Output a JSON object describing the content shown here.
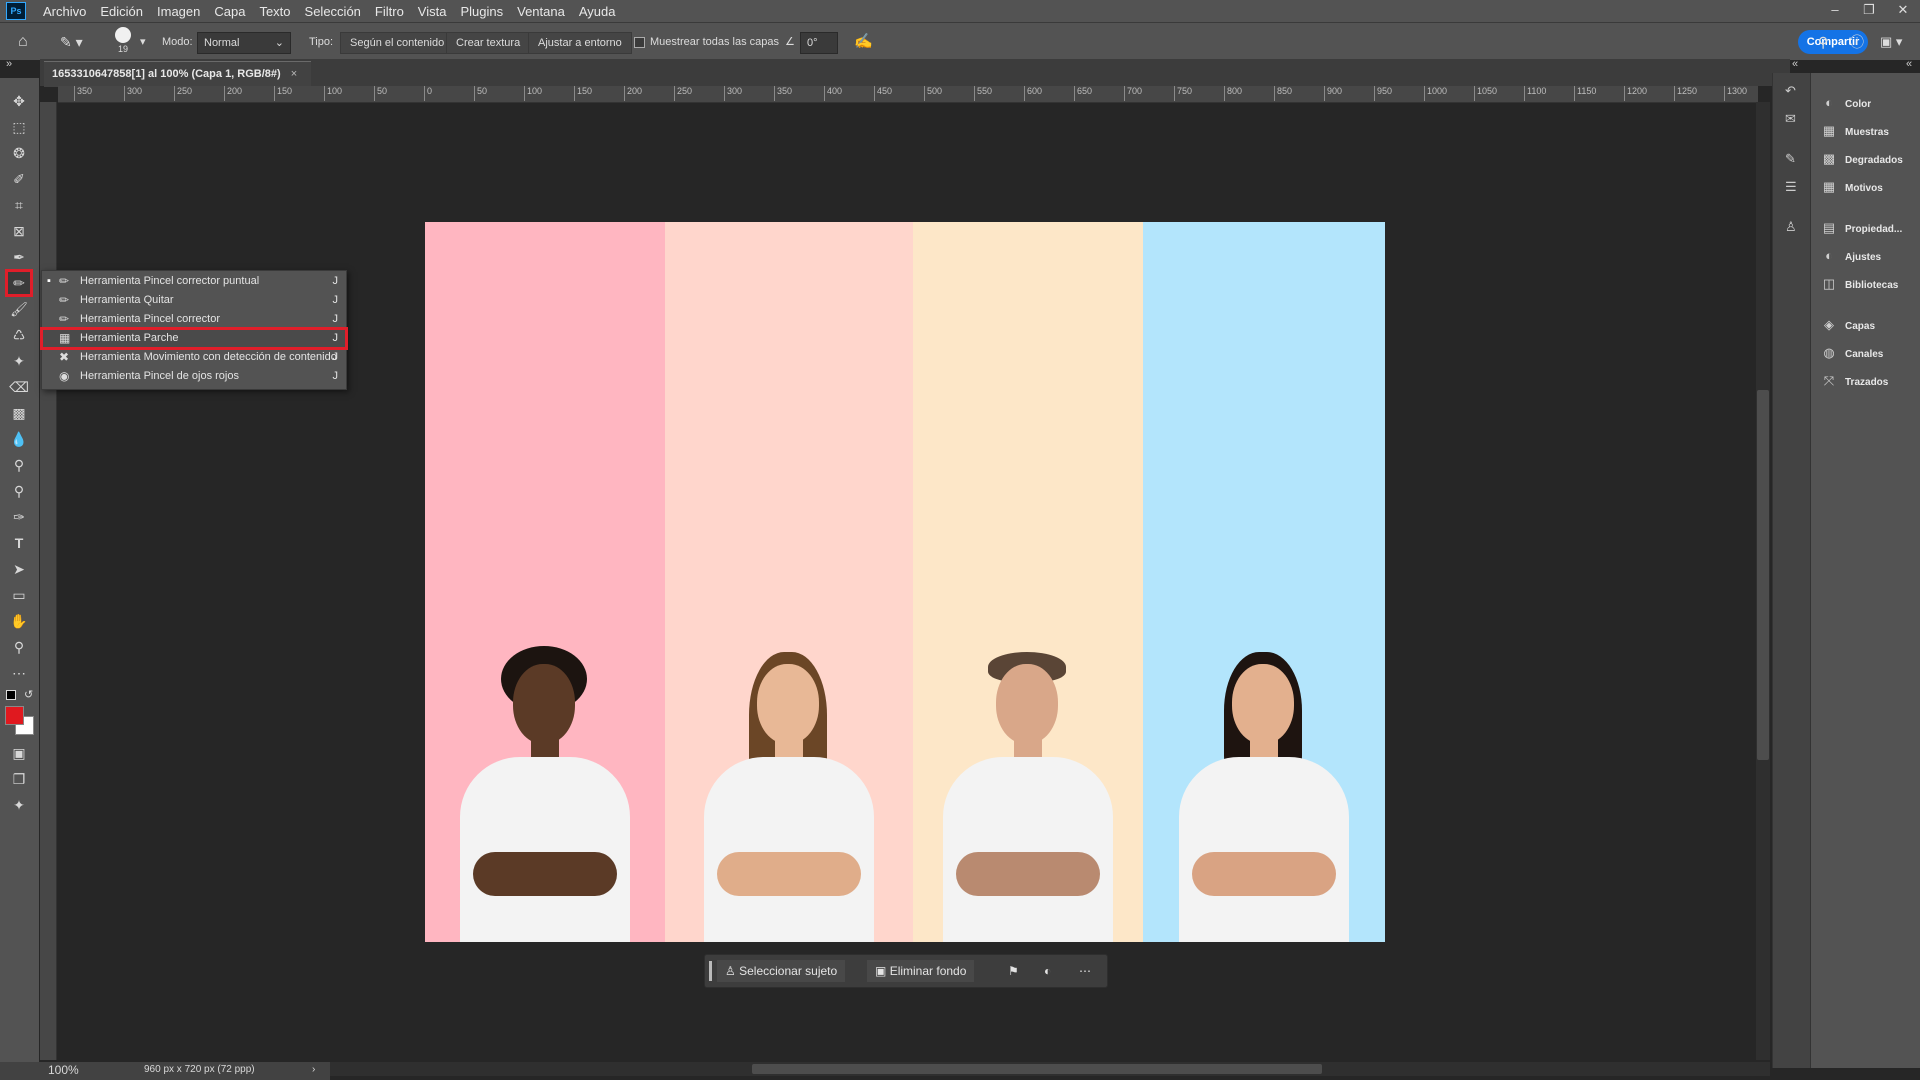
{
  "app": {
    "logo": "Ps"
  },
  "menu": [
    "Archivo",
    "Edición",
    "Imagen",
    "Capa",
    "Texto",
    "Selección",
    "Filtro",
    "Vista",
    "Plugins",
    "Ventana",
    "Ayuda"
  ],
  "options": {
    "brush_size": "19",
    "mode_label": "Modo:",
    "mode_value": "Normal",
    "type_label": "Tipo:",
    "type_buttons": [
      "Según el contenido",
      "Crear textura",
      "Ajustar a entorno"
    ],
    "sample_all_layers": "Muestrear todas las capas",
    "angle_value": "0°",
    "share": "Compartir"
  },
  "document": {
    "tab_title": "1653310647858[1] al 100% (Capa 1, RGB/8#)",
    "zoom": "100%",
    "doc_size": "960 px x 720 px (72 ppp)"
  },
  "ruler": {
    "h_ticks": [
      "350",
      "300",
      "250",
      "200",
      "150",
      "100",
      "50",
      "0",
      "50",
      "100",
      "150",
      "200",
      "250",
      "300",
      "350",
      "400",
      "450",
      "500",
      "550",
      "600",
      "650",
      "700",
      "750",
      "800",
      "850",
      "900",
      "950",
      "1000",
      "1050",
      "1100",
      "1150",
      "1200",
      "1250",
      "1300"
    ]
  },
  "flyout": {
    "items": [
      {
        "label": "Herramienta Pincel corrector puntual",
        "key": "J",
        "icon": "spot-healing-brush-icon",
        "active": true
      },
      {
        "label": "Herramienta Quitar",
        "key": "J",
        "icon": "remove-tool-icon",
        "active": false
      },
      {
        "label": "Herramienta Pincel corrector",
        "key": "J",
        "icon": "healing-brush-icon",
        "active": false
      },
      {
        "label": "Herramienta Parche",
        "key": "J",
        "icon": "patch-tool-icon",
        "active": false,
        "highlighted": true
      },
      {
        "label": "Herramienta Movimiento con detección de contenido",
        "key": "J",
        "icon": "content-aware-move-icon",
        "active": false
      },
      {
        "label": "Herramienta Pincel de ojos rojos",
        "key": "J",
        "icon": "red-eye-icon",
        "active": false
      }
    ]
  },
  "taskbar": {
    "select_subject": "Seleccionar sujeto",
    "remove_background": "Eliminar fondo"
  },
  "panels": {
    "group1": [
      "Color",
      "Muestras",
      "Degradados",
      "Motivos"
    ],
    "group2": [
      "Propiedad...",
      "Ajustes",
      "Bibliotecas"
    ],
    "group3": [
      "Capas",
      "Canales",
      "Trazados"
    ]
  },
  "colors": {
    "foreground": "#e0191f",
    "background": "#ffffff",
    "accent": "#1473e6",
    "strips": [
      "#ffb6c1",
      "#ffd6cc",
      "#fde7c8",
      "#b3e5fc"
    ]
  }
}
